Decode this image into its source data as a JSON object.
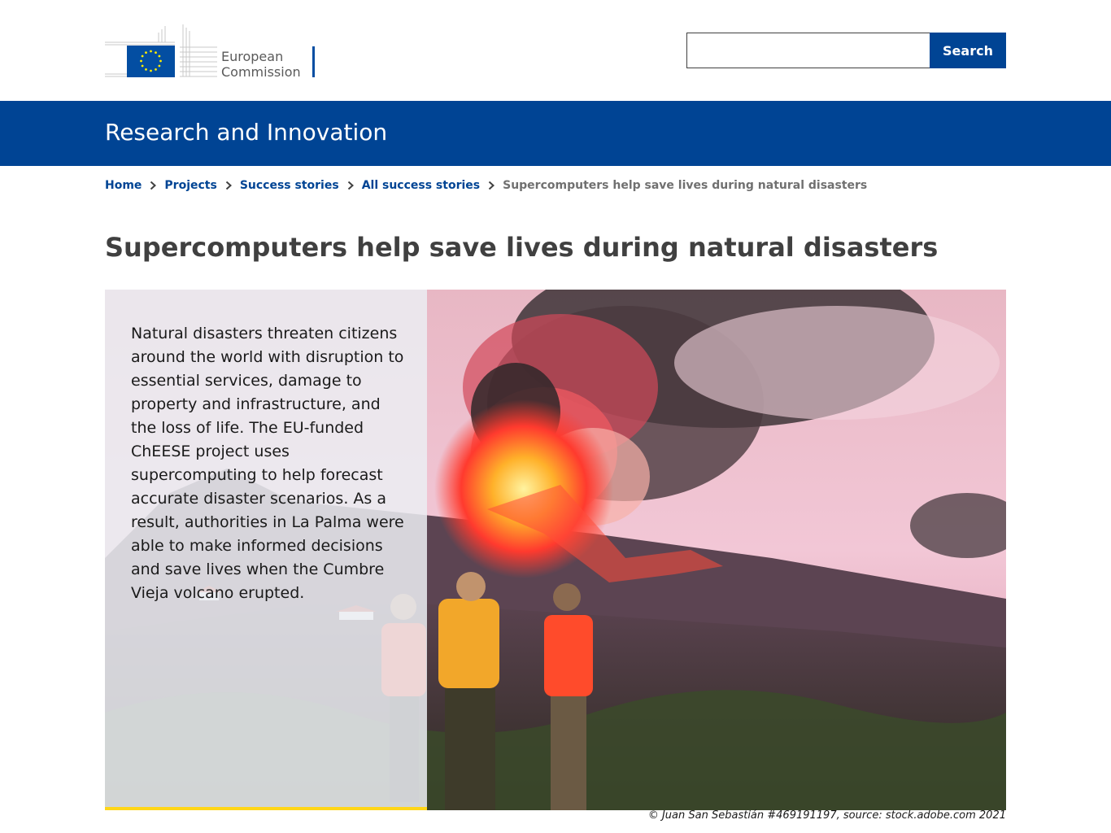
{
  "header": {
    "logo": {
      "line1": "European",
      "line2": "Commission",
      "colors": {
        "flag_blue": "#034EA2",
        "star_yellow": "#FFED00",
        "text": "#5a5a5a"
      }
    },
    "search": {
      "placeholder": "",
      "value": "",
      "button_label": "Search"
    }
  },
  "banner": {
    "site_name": "Research and Innovation",
    "color": "#004494"
  },
  "breadcrumb": {
    "items": [
      "Home",
      "Projects",
      "Success stories",
      "All success stories"
    ],
    "current": "Supercomputers help save lives during natural disasters",
    "separator_icon": "chevron-right-icon"
  },
  "page": {
    "title": "Supercomputers help save lives during natural disasters",
    "intro": "Natural disasters threaten citizens around the world with disruption to essential services, damage to property and infrastructure, and the loss of life. The EU-funded ChEESE project uses supercomputing to help forecast accurate disaster scenarios. As a result, authorities in La Palma were able to make informed decisions and save lives when the Cumbre Vieja volcano erupted.",
    "image_credit": "© Juan San Sebastián #469191197, source: stock.adobe.com 2021",
    "accent_color": "#FFD617"
  }
}
